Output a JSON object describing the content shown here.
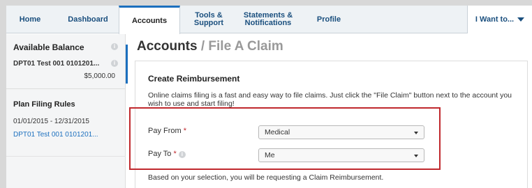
{
  "nav": {
    "items": [
      {
        "label": "Home"
      },
      {
        "label": "Dashboard"
      },
      {
        "label": "Accounts"
      },
      {
        "line1": "Tools &",
        "line2": "Support"
      },
      {
        "line1": "Statements &",
        "line2": "Notifications"
      },
      {
        "label": "Profile"
      }
    ],
    "iwant_label": "I Want to..."
  },
  "sidebar": {
    "available_balance_title": "Available Balance",
    "account_name": "DPT01 Test 001 0101201...",
    "account_amount": "$5,000.00",
    "plan_filing_title": "Plan Filing Rules",
    "plan_dates": "01/01/2015 - 12/31/2015",
    "plan_account_link": "DPT01 Test 001 0101201..."
  },
  "page": {
    "title": "Accounts",
    "separator": " / ",
    "subtitle": "File A Claim"
  },
  "card": {
    "title": "Create Reimbursement",
    "description": "Online claims filing is a fast and easy way to file claims. Just click the \"File Claim\" button next to the account you wish to use and start filing!",
    "pay_from_label": "Pay From",
    "pay_from_value": "Medical",
    "pay_to_label": "Pay To",
    "pay_to_value": "Me",
    "required_mark": "*",
    "note": "Based on your selection, you will be requesting a Claim Reimbursement."
  },
  "icons": {
    "info": "info-icon",
    "caret": "caret-down-icon"
  },
  "colors": {
    "accent": "#1b6fbe",
    "nav_text": "#1a4f7e",
    "highlight": "#c0282d"
  }
}
